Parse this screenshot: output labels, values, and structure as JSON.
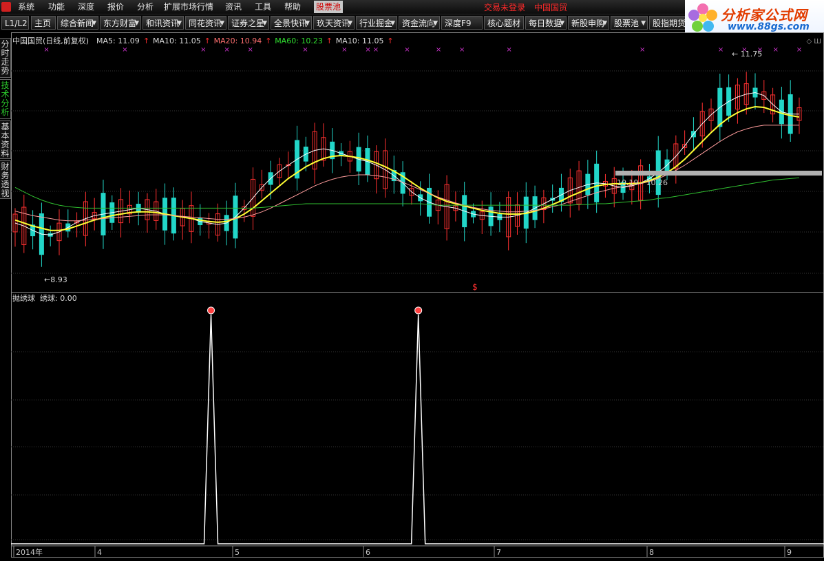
{
  "menubar": {
    "items": [
      "系统",
      "功能",
      "深度",
      "报价",
      "分析",
      "扩展市场行情",
      "资讯",
      "工具",
      "帮助",
      "股票池"
    ],
    "active_item": "股票池",
    "login_status": "交易未登录",
    "stock_name": "中国国贸"
  },
  "toolbar": {
    "level": "L1/L2",
    "tabs": [
      "主页",
      "综合新闻",
      "东方财富",
      "和讯资讯",
      "同花资讯",
      "证券之星",
      "全景快讯",
      "玖天资讯",
      "行业掘金",
      "资金流向",
      "深度F9",
      "核心题材",
      "每日数据",
      "新股申购",
      "股票池",
      "股指期货"
    ],
    "dropdown_tabs": [
      "综合新闻",
      "东方财富",
      "和讯资讯",
      "同花资讯",
      "证券之星",
      "全景快讯",
      "玖天资讯",
      "行业掘金",
      "资金流向",
      "每日数据",
      "新股申购",
      "股票池"
    ],
    "dropdown_arrow": "▼"
  },
  "watermark": {
    "title": "分析家公式网",
    "url": "www.88gs.com"
  },
  "sidetabs": [
    {
      "label": "分时走势",
      "active": false
    },
    {
      "label": "技术分析",
      "active": true
    },
    {
      "label": "基本资料",
      "active": false
    },
    {
      "label": "财务透视",
      "active": false
    }
  ],
  "main_chart": {
    "title": "中国国贸(日线,前复权)",
    "up_arrow": "↑",
    "ma_legend": [
      {
        "label": "MA5: 11.09",
        "color": "#dddddd"
      },
      {
        "label": "MA10: 11.05",
        "color": "#dddddd"
      },
      {
        "label": "MA20: 10.94",
        "color": "#ff7070"
      },
      {
        "label": "MA60: 10.23",
        "color": "#30e030"
      },
      {
        "label": "MA10: 11.05",
        "color": "#dddddd"
      }
    ],
    "annotations": {
      "high": "11.75",
      "low": "8.93",
      "range_label": "10.19 - 10.26",
      "high_arrow": "←",
      "low_arrow": "←",
      "dividend_mark": "$",
      "corner_icons": "◇ Ш"
    },
    "colors": {
      "up": "#ff3030",
      "down": "#22d6c8",
      "ma5": "#ffffff",
      "ma10": "#ffff33",
      "ma20": "#ff9c9c",
      "ma60": "#30c030",
      "mark": "#cc33cc"
    }
  },
  "indicator_chart": {
    "name": "抛绣球",
    "series_label": "绣球: 0.00"
  },
  "chart_data": {
    "type": "line",
    "title": "中国国贸(日线,前复权)",
    "xlabel": "",
    "ylabel": "",
    "x_ticks": [
      "2014年",
      "4",
      "5",
      "6",
      "7",
      "8",
      "9"
    ],
    "series": [
      {
        "name": "MA5",
        "values": [
          9.62,
          9.58,
          9.52,
          9.47,
          9.46,
          9.5,
          9.56,
          9.63,
          9.68,
          9.72,
          9.74,
          9.76,
          9.78,
          9.8,
          9.82,
          9.8,
          9.78,
          9.74,
          9.72,
          9.7,
          9.68,
          9.64,
          9.62,
          9.6,
          9.62,
          9.7,
          9.82,
          9.96,
          10.1,
          10.22,
          10.32,
          10.4,
          10.48,
          10.55,
          10.6,
          10.62,
          10.6,
          10.56,
          10.52,
          10.48,
          10.45,
          10.4,
          10.34,
          10.26,
          10.16,
          10.04,
          9.96,
          9.9,
          9.86,
          9.84,
          9.82,
          9.78,
          9.74,
          9.72,
          9.71,
          9.7,
          9.7,
          9.72,
          9.76,
          9.82,
          9.88,
          9.94,
          10.0,
          10.06,
          10.1,
          10.14,
          10.16,
          10.15,
          10.12,
          10.1,
          10.12,
          10.16,
          10.22,
          10.3,
          10.4,
          10.52,
          10.66,
          10.82,
          10.96,
          11.08,
          11.18,
          11.26,
          11.32,
          11.36,
          11.38,
          11.34,
          11.22,
          11.12,
          11.09,
          11.09
        ]
      },
      {
        "name": "MA10",
        "values": [
          9.66,
          9.62,
          9.58,
          9.55,
          9.52,
          9.52,
          9.54,
          9.58,
          9.62,
          9.66,
          9.69,
          9.72,
          9.74,
          9.76,
          9.77,
          9.77,
          9.76,
          9.74,
          9.72,
          9.7,
          9.68,
          9.66,
          9.64,
          9.63,
          9.64,
          9.68,
          9.74,
          9.82,
          9.92,
          10.02,
          10.12,
          10.22,
          10.3,
          10.38,
          10.44,
          10.49,
          10.52,
          10.53,
          10.52,
          10.5,
          10.47,
          10.43,
          10.38,
          10.32,
          10.25,
          10.17,
          10.09,
          10.02,
          9.96,
          9.91,
          9.88,
          9.85,
          9.82,
          9.79,
          9.77,
          9.75,
          9.74,
          9.74,
          9.75,
          9.78,
          9.82,
          9.87,
          9.92,
          9.98,
          10.03,
          10.08,
          10.12,
          10.14,
          10.15,
          10.15,
          10.15,
          10.16,
          10.19,
          10.24,
          10.3,
          10.38,
          10.48,
          10.6,
          10.72,
          10.84,
          10.95,
          11.04,
          11.11,
          11.16,
          11.19,
          11.18,
          11.14,
          11.1,
          11.07,
          11.05
        ]
      },
      {
        "name": "MA20",
        "values": [
          9.78,
          9.75,
          9.72,
          9.7,
          9.68,
          9.66,
          9.65,
          9.65,
          9.66,
          9.67,
          9.68,
          9.69,
          9.7,
          9.71,
          9.72,
          9.73,
          9.73,
          9.73,
          9.72,
          9.71,
          9.7,
          9.69,
          9.68,
          9.67,
          9.67,
          9.68,
          9.7,
          9.73,
          9.77,
          9.82,
          9.88,
          9.94,
          10.0,
          10.06,
          10.12,
          10.17,
          10.21,
          10.24,
          10.26,
          10.27,
          10.27,
          10.26,
          10.24,
          10.21,
          10.17,
          10.12,
          10.07,
          10.02,
          9.97,
          9.93,
          9.89,
          9.86,
          9.83,
          9.81,
          9.79,
          9.78,
          9.77,
          9.77,
          9.78,
          9.79,
          9.81,
          9.84,
          9.87,
          9.91,
          9.95,
          9.99,
          10.03,
          10.06,
          10.09,
          10.11,
          10.13,
          10.15,
          10.18,
          10.22,
          10.27,
          10.33,
          10.4,
          10.48,
          10.56,
          10.64,
          10.72,
          10.79,
          10.85,
          10.89,
          10.92,
          10.94,
          10.94,
          10.94,
          10.94,
          10.94
        ]
      },
      {
        "name": "MA60",
        "values": [
          10.1,
          10.04,
          9.98,
          9.93,
          9.89,
          9.86,
          9.84,
          9.83,
          9.82,
          9.82,
          9.82,
          9.82,
          9.82,
          9.82,
          9.82,
          9.82,
          9.82,
          9.82,
          9.82,
          9.82,
          9.82,
          9.82,
          9.82,
          9.82,
          9.82,
          9.82,
          9.82,
          9.82,
          9.83,
          9.84,
          9.85,
          9.86,
          9.87,
          9.88,
          9.88,
          9.88,
          9.88,
          9.88,
          9.88,
          9.88,
          9.88,
          9.88,
          9.88,
          9.88,
          9.88,
          9.88,
          9.88,
          9.87,
          9.86,
          9.86,
          9.86,
          9.86,
          9.86,
          9.86,
          9.86,
          9.86,
          9.86,
          9.86,
          9.86,
          9.86,
          9.86,
          9.86,
          9.86,
          9.86,
          9.87,
          9.87,
          9.88,
          9.88,
          9.89,
          9.9,
          9.91,
          9.92,
          9.93,
          9.95,
          9.96,
          9.98,
          10.0,
          10.02,
          10.04,
          10.06,
          10.08,
          10.1,
          10.12,
          10.14,
          10.16,
          10.18,
          10.2,
          10.21,
          10.22,
          10.23
        ]
      }
    ],
    "ylim": [
      8.7,
      12.1
    ],
    "indicator_series": {
      "name": "绣球",
      "ylim": [
        0,
        1
      ],
      "spikes_at_fraction": [
        0.246,
        0.501
      ]
    }
  }
}
